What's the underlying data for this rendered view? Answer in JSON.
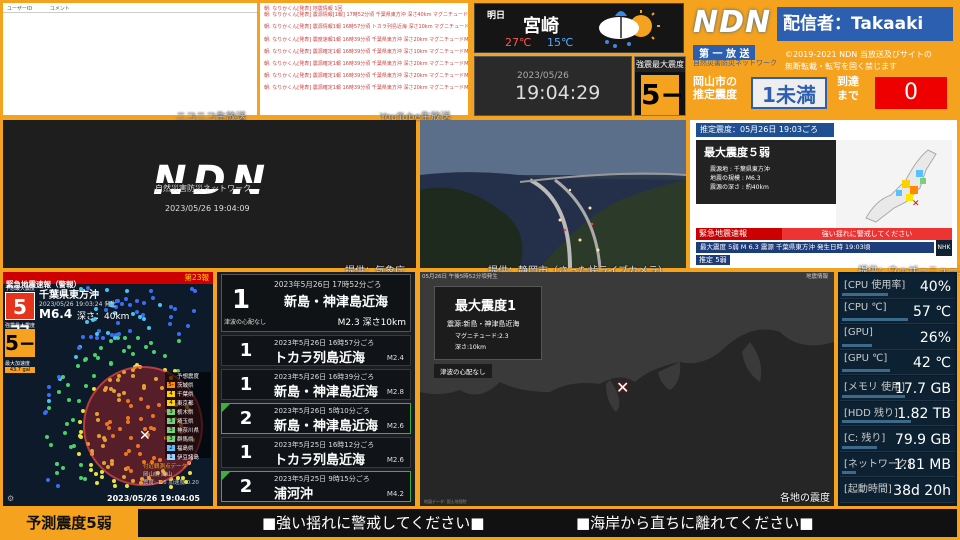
{
  "comments_left": {
    "col1": "ユーザーID",
    "col2": "コメント",
    "label": "ニコニコ生放送"
  },
  "comments_right": {
    "label": "YouTube生放送",
    "lines": [
      "朝: なりかくん[発表]  地震情報  1回",
      "朝: なりかくん[発表]  震源情報[1報] 17時52分頃 千葉県東方沖 深さ40km マグニチュードM5.8 予想最大震度5弱",
      "朝: なりかくん[発表]  震源情報1報 16時57分頃 トカラ列島近海 深さ10km マグニチュードM2.4 予想最大震度1",
      "朝: なりかくん[発表]  震度速報1報 16時39分頃 千葉県東方沖 深さ20km マグニチュードM6.4 予想最大震度5弱",
      "朝: なりかくん[発表]  震源確定1報 16時39分頃 千葉県東方沖 深さ10km マグニチュードM6.1 予想震度5弱",
      "朝: なりかくん[発表]  震源確定1報 16時39分頃 千葉県東方沖 深さ20km マグニチュードM6.4 予想震度5弱",
      "朝: なりかくん[発表]  震源確定1報 16時39分頃 千葉県東方沖 深さ20km マグニチュードM6.9 予想震度5弱",
      "朝: なりかくん[発表]  震源確定1報 16時39分頃 千葉県東方沖 深さ20km マグニチュードM6.3 予想震度5弱"
    ]
  },
  "weather": {
    "when": "明日",
    "city": "宮崎",
    "high": "27℃",
    "low": "15℃"
  },
  "brand": {
    "logo": "NDN",
    "broadcaster": "配信者：Takaaki",
    "first_report": "第 一 放 送",
    "sub": "自然災害防災ネットワーク",
    "copyright1": "©2019-2021 NDN 当放送及びサイトの",
    "copyright2": "無断転載・転写を固く禁じます"
  },
  "clock": {
    "date": "2023/05/26",
    "time": "19:04:29"
  },
  "max_intensity": {
    "label": "強震最大震度",
    "value": "5−"
  },
  "local": {
    "label": "岡山市の推定震度",
    "value": "1未満",
    "arrival_label": "到達まで",
    "arrival": "0"
  },
  "ndn_panel": {
    "logo": "NDN",
    "sub": "自然災害防災ネットワーク",
    "datetime": "2023/05/26 19:04:09"
  },
  "camera": {
    "credit": "提供：静岡市（さった峠ライブカメラ）",
    "credit_jma": "提供：気象庁"
  },
  "news": {
    "header": "推定震度：05月26日 19:03ごろ",
    "max": "最大震度５弱",
    "line1": "震源地 : 千葉県東方沖",
    "line2": "地震の規模 : M6.3",
    "line3": "震源の深さ : 約40km",
    "alert": "緊急地震速報",
    "alert_sub": "強い揺れに警戒してください",
    "bottom": "最大震度 5弱  M 6.3  震源 千葉県東方沖  発生日時 19:03頃",
    "tag": "推定 5弱"
  },
  "eew": {
    "header": "緊急地震速報（警報）",
    "count": "第23報",
    "max_label": "予想最大震度",
    "region": "千葉県東方沖",
    "issued": "2023/05/26 19:03:24 発生",
    "mag": "M6.4",
    "depth": "深さ：40km",
    "intensity": "5弱",
    "strong_label": "強震最大震度",
    "strong": "5−",
    "acc_label": "最大加速度",
    "acc": "43.7 gal",
    "legend_title": "予想震度",
    "prefs": [
      "茨城県",
      "千葉県",
      "東京都",
      "栃木県",
      "埼玉県",
      "神奈川県",
      "群馬県",
      "福島県",
      "伊豆諸島"
    ],
    "legend_ints": [
      "5-",
      "4",
      "4",
      "3",
      "3",
      "3",
      "3",
      "2",
      "1"
    ],
    "obs_title": "付近観測点データ",
    "obs1": "岡山県 岡山",
    "obs2": "震度:-1.6  加速度 0.20",
    "time": "2023/05/26 19:04:05"
  },
  "quakes": {
    "credit": "提供：気象庁",
    "top": {
      "int": "1",
      "time": "2023年5月26日 17時52分ごろ",
      "name": "新島・神津島近海",
      "tsunami": "津波の心配なし",
      "mag": "M2.3 深さ10km"
    },
    "items": [
      {
        "int": "1",
        "time": "2023年5月26日 16時57分ごろ",
        "name": "トカラ列島近海",
        "mag": "M2.4"
      },
      {
        "int": "1",
        "time": "2023年5月26日 16時39分ごろ",
        "name": "新島・神津島近海",
        "mag": "M2.8"
      },
      {
        "int": "2",
        "time": "2023年5月26日 5時10分ごろ",
        "name": "新島・神津島近海",
        "mag": "M2.6"
      },
      {
        "int": "1",
        "time": "2023年5月25日 16時12分ごろ",
        "name": "トカラ列島近海",
        "mag": "M2.6"
      },
      {
        "int": "2",
        "time": "2023年5月25日 9時15分ごろ",
        "name": "浦河沖",
        "mag": "M4.2"
      }
    ]
  },
  "map": {
    "header": "05月26日 午後5時52分頃発生",
    "layer": "地震情報",
    "title": "最大震度1",
    "epicenter": "震源:新島・神津島近海",
    "mag": "マグニチュード:2.3",
    "depth": "深さ:10km",
    "tsunami": "津波の心配なし",
    "footer": "各地の震度",
    "credit": "提供：ウェザーニュース",
    "attrib": "地図データ: 国土地理院"
  },
  "resources": [
    {
      "label": "[CPU 使用率]",
      "value": "40%",
      "pct": 0.4
    },
    {
      "label": "[CPU ℃]",
      "value": "57 ℃",
      "pct": 0.57
    },
    {
      "label": "[GPU]",
      "value": "26%",
      "pct": 0.26
    },
    {
      "label": "[GPU ℃]",
      "value": "42 ℃",
      "pct": 0.42
    },
    {
      "label": "[メモリ 使用]",
      "value": "17.7 GB",
      "pct": 0.55
    },
    {
      "label": "[HDD 残り]",
      "value": "1.82 TB",
      "pct": 0.6
    },
    {
      "label": "[C: 残り]",
      "value": "79.9 GB",
      "pct": 0.3
    },
    {
      "label": "[ネットワーク]",
      "value": "1.81 MB",
      "pct": 0.12
    },
    {
      "label": "[起動時間]",
      "value": "38d 20h",
      "pct": 0.0
    }
  ],
  "ticker": {
    "label": "予測震度5弱",
    "msg1": "■強い揺れに警戒してください■",
    "msg2": "■海岸から直ちに離れてください■"
  }
}
